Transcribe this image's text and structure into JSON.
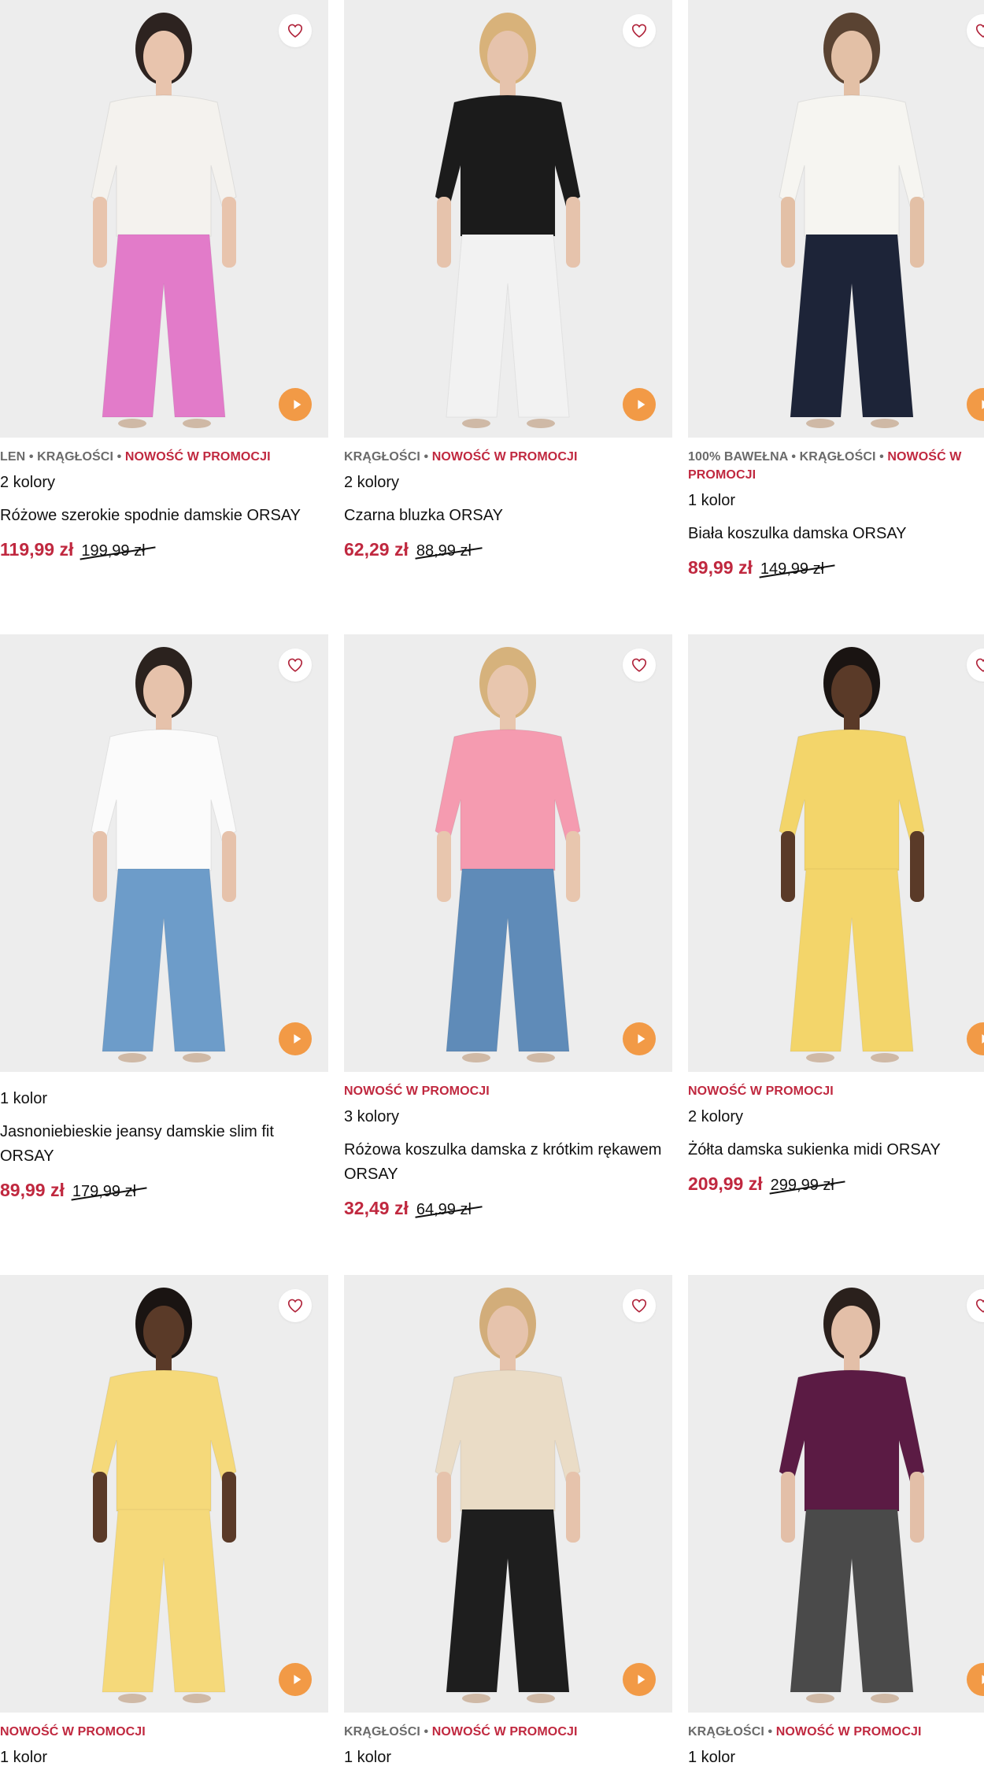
{
  "products": [
    {
      "tags": [
        "LEN",
        "KRĄGŁOŚCI"
      ],
      "promo": "NOWOŚĆ W PROMOCJI",
      "colors": "2 kolory",
      "title": "Różowe szerokie spodnie damskie ORSAY",
      "price": "119,99 zł",
      "old_price": "199,99 zł",
      "top_color": "#f4f2ee",
      "bottom_color": "#e27bc9",
      "skin": "#e8c4ad",
      "hair": "#2d2320"
    },
    {
      "tags": [
        "KRĄGŁOŚCI"
      ],
      "promo": "NOWOŚĆ W PROMOCJI",
      "colors": "2 kolory",
      "title": "Czarna bluzka ORSAY",
      "price": "62,29 zł",
      "old_price": "88,99 zł",
      "top_color": "#1b1b1b",
      "bottom_color": "#f2f2f2",
      "skin": "#e6c3ac",
      "hair": "#d8b27a"
    },
    {
      "tags": [
        "100% BAWEŁNA",
        "KRĄGŁOŚCI"
      ],
      "promo": "NOWOŚĆ W PROMOCJI",
      "colors": "1 kolor",
      "title": "Biała koszulka damska ORSAY",
      "price": "89,99 zł",
      "old_price": "149,99 zł",
      "top_color": "#f6f5f1",
      "bottom_color": "#1d2438",
      "skin": "#e3c0a6",
      "hair": "#5a4332"
    },
    {
      "tags": [],
      "promo": "",
      "colors": "1 kolor",
      "title": "Jasnoniebieskie jeansy damskie slim fit ORSAY",
      "price": "89,99 zł",
      "old_price": "179,99 zł",
      "top_color": "#fbfbfb",
      "bottom_color": "#6d9cc9",
      "skin": "#e6c2ab",
      "hair": "#2b221e"
    },
    {
      "tags": [],
      "promo": "NOWOŚĆ W PROMOCJI",
      "colors": "3 kolory",
      "title": "Różowa koszulka damska z krótkim rękawem ORSAY",
      "price": "32,49 zł",
      "old_price": "64,99 zł",
      "top_color": "#f59bb0",
      "bottom_color": "#5f8bb8",
      "skin": "#e8c6ae",
      "hair": "#d6b27c"
    },
    {
      "tags": [],
      "promo": "NOWOŚĆ W PROMOCJI",
      "colors": "2 kolory",
      "title": "Żółta damska sukienka midi ORSAY",
      "price": "209,99 zł",
      "old_price": "299,99 zł",
      "top_color": "#f3d56a",
      "bottom_color": "#f3d56a",
      "skin": "#5a3a28",
      "hair": "#1a1412"
    },
    {
      "tags": [],
      "promo": "NOWOŚĆ W PROMOCJI",
      "colors": "1 kolor",
      "title": "",
      "price": "",
      "old_price": "",
      "top_color": "#f5d97a",
      "bottom_color": "#f5d97a",
      "skin": "#5a3a28",
      "hair": "#1a1412"
    },
    {
      "tags": [
        "KRĄGŁOŚCI"
      ],
      "promo": "NOWOŚĆ W PROMOCJI",
      "colors": "1 kolor",
      "title": "",
      "price": "",
      "old_price": "",
      "top_color": "#eadcc6",
      "bottom_color": "#1e1e1e",
      "skin": "#e6c3ac",
      "hair": "#d2ad7a"
    },
    {
      "tags": [
        "KRĄGŁOŚCI"
      ],
      "promo": "NOWOŚĆ W PROMOCJI",
      "colors": "1 kolor",
      "title": "",
      "price": "",
      "old_price": "",
      "top_color": "#5b1b44",
      "bottom_color": "#4a4a4a",
      "skin": "#e3bfa8",
      "hair": "#2a201c"
    }
  ],
  "icons": {
    "favorite": "heart-outline-icon",
    "video": "play-icon"
  },
  "accent_colors": {
    "promo": "#c0283f",
    "price": "#c0283f",
    "play": "#f29a46"
  }
}
